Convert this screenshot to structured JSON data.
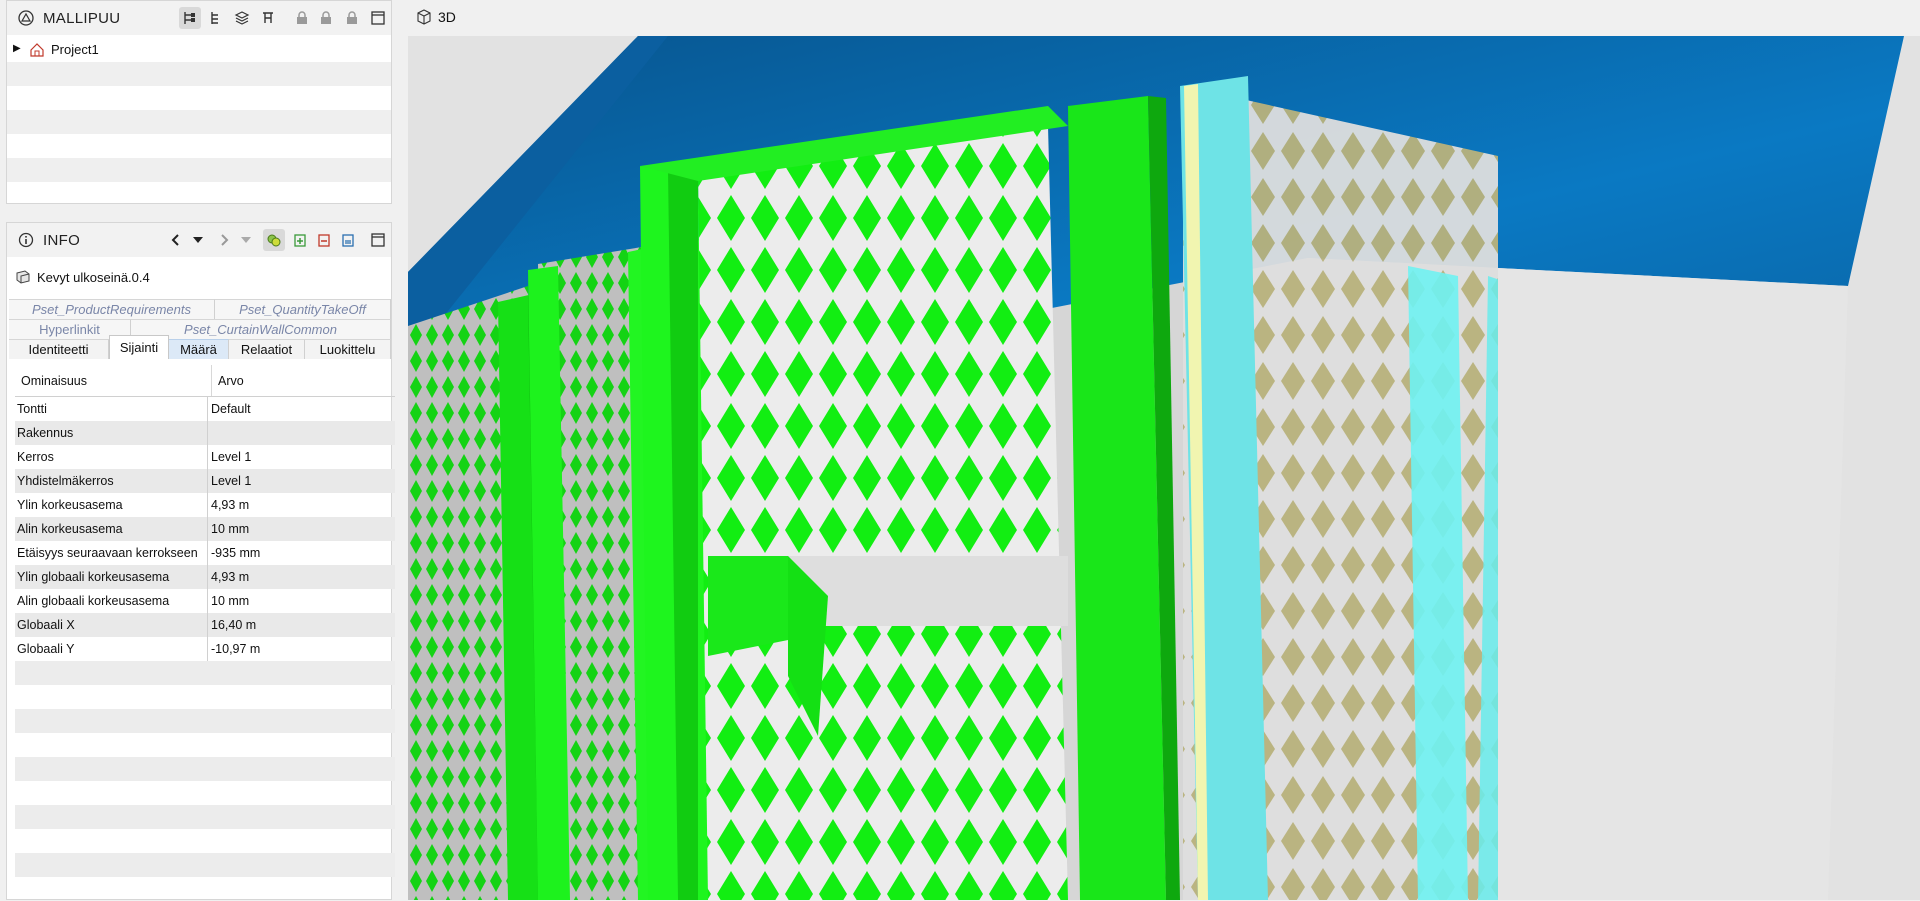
{
  "model_tree": {
    "title": "MALLIPUU",
    "items": [
      {
        "label": "Project1"
      }
    ]
  },
  "info": {
    "title": "INFO",
    "object_name": "Kevyt ulkoseinä.0.4",
    "tabs_row1": [
      "Pset_ProductRequirements",
      "Pset_QuantityTakeOff"
    ],
    "tabs_row2": [
      "Hyperlinkit",
      "Pset_CurtainWallCommon"
    ],
    "tabs_row3": [
      "Identiteetti",
      "Sijainti",
      "Määrä",
      "Relaatiot",
      "Luokittelu"
    ],
    "selected_tab": "Sijainti",
    "table": {
      "headers": [
        "Ominaisuus",
        "Arvo"
      ],
      "rows": [
        [
          "Tontti",
          "Default"
        ],
        [
          "Rakennus",
          ""
        ],
        [
          "Kerros",
          "Level 1"
        ],
        [
          "Yhdistelmäkerros",
          "Level 1"
        ],
        [
          "Ylin korkeusasema",
          "4,93 m"
        ],
        [
          "Alin korkeusasema",
          "10 mm"
        ],
        [
          "Etäisyys seuraavaan kerrokseen",
          "-935 mm"
        ],
        [
          "Ylin globaali korkeusasema",
          "4,93 m"
        ],
        [
          "Alin globaali korkeusasema",
          "10 mm"
        ],
        [
          "Globaali X",
          "16,40 m"
        ],
        [
          "Globaali Y",
          "-10,97 m"
        ]
      ]
    }
  },
  "viewport": {
    "title": "3D"
  },
  "icons": {
    "tree_toolbar": [
      "hierarchy-icon",
      "tree-icon",
      "layers-icon",
      "split-tree-icon",
      "lock-icon",
      "lock-icon",
      "lock-icon",
      "window-icon"
    ],
    "info_toolbar": [
      "back-arrow-icon",
      "dropdown-icon",
      "forward-arrow-icon",
      "dropdown-icon",
      "link-objects-icon",
      "add-icon",
      "remove-icon",
      "edit-icon",
      "window-icon"
    ]
  },
  "colors": {
    "green": "#00ff00",
    "blue_ceiling": "#0a72b8",
    "cyan": "#6ee3e6",
    "tan": "#b8b07a",
    "selected_tab_bg": "#dce9f7"
  }
}
